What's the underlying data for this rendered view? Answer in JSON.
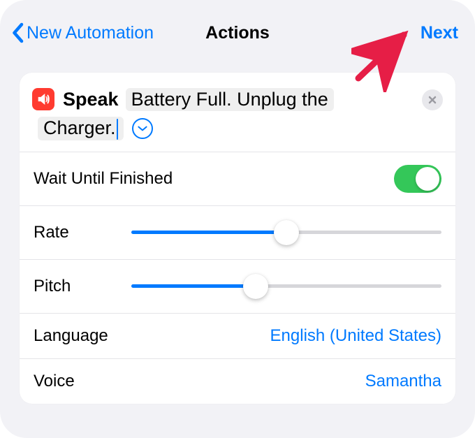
{
  "nav": {
    "back_label": "New Automation",
    "title": "Actions",
    "next_label": "Next"
  },
  "action": {
    "name": "Speak",
    "text_line1": "Battery Full. Unplug the",
    "text_line2": "Charger."
  },
  "settings": {
    "wait_label": "Wait Until Finished",
    "wait_on": true,
    "rate_label": "Rate",
    "rate_value": 0.5,
    "pitch_label": "Pitch",
    "pitch_value": 0.4,
    "language_label": "Language",
    "language_value": "English (United States)",
    "voice_label": "Voice",
    "voice_value": "Samantha"
  }
}
